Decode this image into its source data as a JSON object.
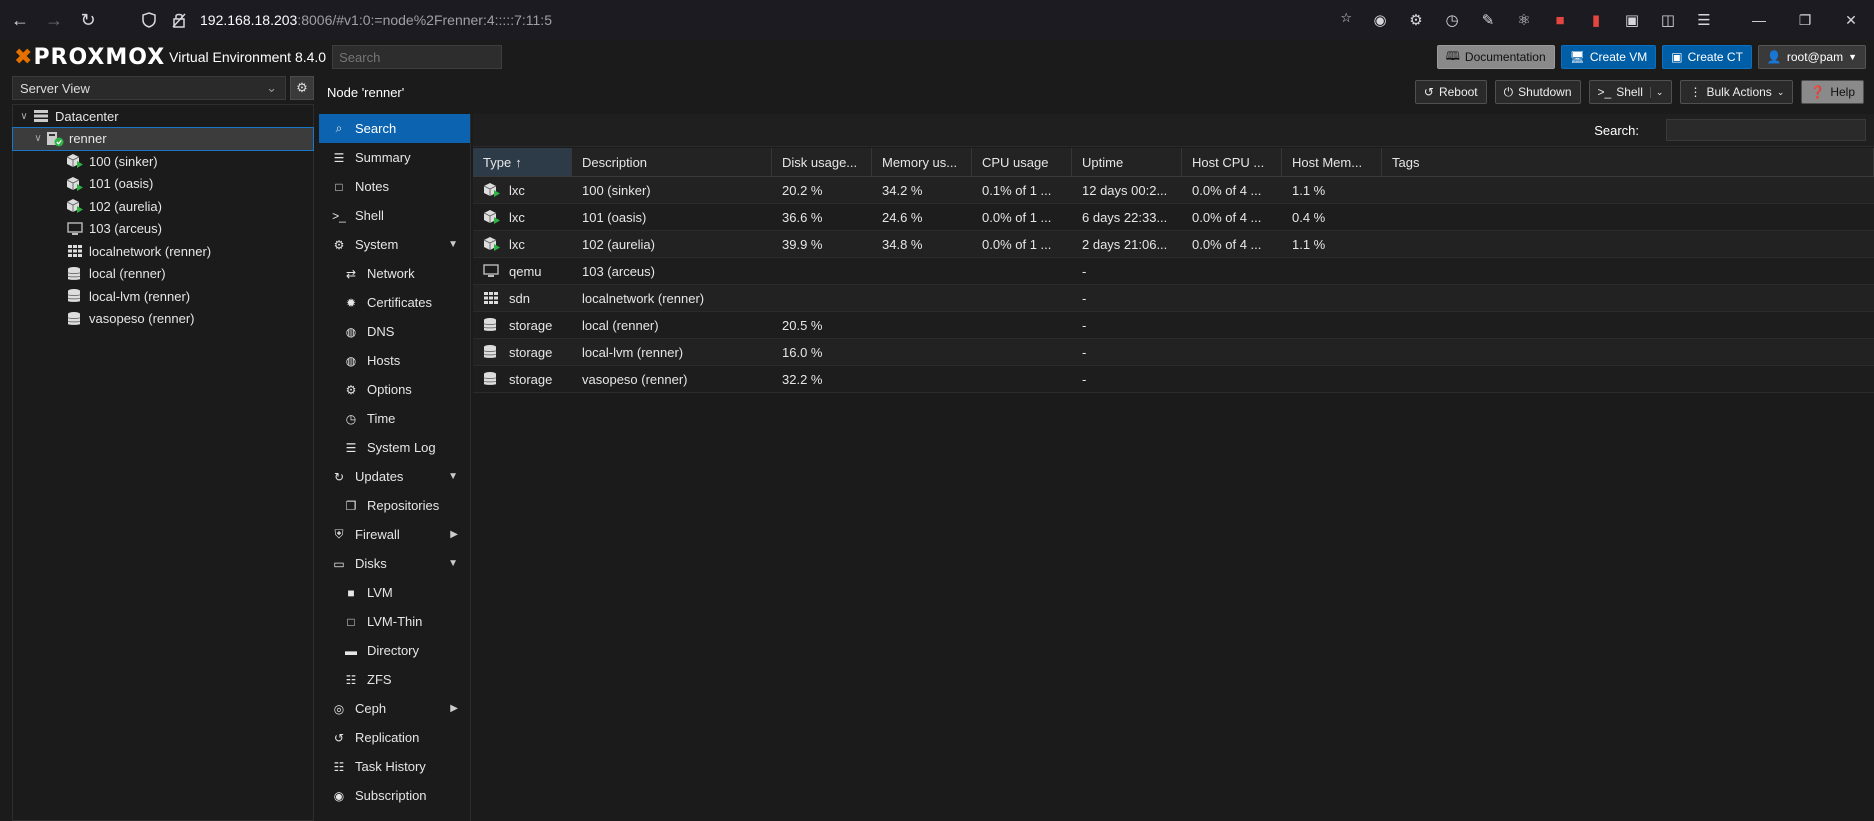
{
  "browser": {
    "url_host": "192.168.18.203",
    "url_rest": ":8006/#v1:0:=node%2Frenner:4:::::7:11:5"
  },
  "header": {
    "logo_text": "PROXMOX",
    "version": "Virtual Environment 8.4.0",
    "search_placeholder": "Search",
    "documentation": "Documentation",
    "create_vm": "Create VM",
    "create_ct": "Create CT",
    "user": "root@pam"
  },
  "left": {
    "view": "Server View",
    "tree": [
      {
        "label": "Datacenter",
        "icon": "datacenter-icon",
        "level": 0
      },
      {
        "label": "renner",
        "icon": "node-online-icon",
        "level": 1,
        "selected": true
      },
      {
        "label": "100 (sinker)",
        "icon": "container-running-icon",
        "level": 2
      },
      {
        "label": "101 (oasis)",
        "icon": "container-running-icon",
        "level": 2
      },
      {
        "label": "102 (aurelia)",
        "icon": "container-running-icon",
        "level": 2
      },
      {
        "label": "103 (arceus)",
        "icon": "vm-monitor-icon",
        "level": 2
      },
      {
        "label": "localnetwork (renner)",
        "icon": "sdn-grid-icon",
        "level": 2
      },
      {
        "label": "local (renner)",
        "icon": "storage-icon",
        "level": 2
      },
      {
        "label": "local-lvm (renner)",
        "icon": "storage-icon",
        "level": 2
      },
      {
        "label": "vasopeso (renner)",
        "icon": "storage-icon",
        "level": 2
      }
    ]
  },
  "node": {
    "title": "Node 'renner'",
    "reboot": "Reboot",
    "shutdown": "Shutdown",
    "shell": "Shell",
    "bulk_actions": "Bulk Actions",
    "help": "Help"
  },
  "nav": [
    {
      "label": "Search",
      "icon": "search-icon",
      "active": true
    },
    {
      "label": "Summary",
      "icon": "summary-icon"
    },
    {
      "label": "Notes",
      "icon": "notes-icon"
    },
    {
      "label": "Shell",
      "icon": "terminal-icon"
    },
    {
      "label": "System",
      "icon": "cogs-icon",
      "caret": "down"
    },
    {
      "label": "Network",
      "icon": "exchange-icon",
      "sub": true
    },
    {
      "label": "Certificates",
      "icon": "certificate-icon",
      "sub": true
    },
    {
      "label": "DNS",
      "icon": "globe-icon",
      "sub": true
    },
    {
      "label": "Hosts",
      "icon": "globe-icon",
      "sub": true
    },
    {
      "label": "Options",
      "icon": "gear-icon",
      "sub": true
    },
    {
      "label": "Time",
      "icon": "clock-icon",
      "sub": true
    },
    {
      "label": "System Log",
      "icon": "list-icon",
      "sub": true
    },
    {
      "label": "Updates",
      "icon": "refresh-icon",
      "caret": "down"
    },
    {
      "label": "Repositories",
      "icon": "repositories-icon",
      "sub": true
    },
    {
      "label": "Firewall",
      "icon": "shield-icon",
      "caret": "right"
    },
    {
      "label": "Disks",
      "icon": "hdd-icon",
      "caret": "down"
    },
    {
      "label": "LVM",
      "icon": "square-icon",
      "sub": true
    },
    {
      "label": "LVM-Thin",
      "icon": "square-outline-icon",
      "sub": true
    },
    {
      "label": "Directory",
      "icon": "folder-icon",
      "sub": true
    },
    {
      "label": "ZFS",
      "icon": "grid-icon",
      "sub": true
    },
    {
      "label": "Ceph",
      "icon": "ceph-icon",
      "caret": "right"
    },
    {
      "label": "Replication",
      "icon": "retweet-icon"
    },
    {
      "label": "Task History",
      "icon": "list-alt-icon"
    },
    {
      "label": "Subscription",
      "icon": "support-icon"
    }
  ],
  "content": {
    "search_label": "Search:",
    "columns": [
      "Type",
      "Description",
      "Disk usage...",
      "Memory us...",
      "CPU usage",
      "Uptime",
      "Host CPU ...",
      "Host Mem...",
      "Tags"
    ],
    "sort_indicator": "↑",
    "rows": [
      {
        "type": "lxc",
        "icon": "container-running-icon",
        "desc": "100 (sinker)",
        "disk": "20.2 %",
        "mem": "34.2 %",
        "cpu": "0.1% of 1 ...",
        "uptime": "12 days 00:2...",
        "hcpu": "0.0% of 4 ...",
        "hmem": "1.1 %",
        "tags": ""
      },
      {
        "type": "lxc",
        "icon": "container-running-icon",
        "desc": "101 (oasis)",
        "disk": "36.6 %",
        "mem": "24.6 %",
        "cpu": "0.0% of 1 ...",
        "uptime": "6 days 22:33...",
        "hcpu": "0.0% of 4 ...",
        "hmem": "0.4 %",
        "tags": ""
      },
      {
        "type": "lxc",
        "icon": "container-running-icon",
        "desc": "102 (aurelia)",
        "disk": "39.9 %",
        "mem": "34.8 %",
        "cpu": "0.0% of 1 ...",
        "uptime": "2 days 21:06...",
        "hcpu": "0.0% of 4 ...",
        "hmem": "1.1 %",
        "tags": ""
      },
      {
        "type": "qemu",
        "icon": "vm-monitor-icon",
        "desc": "103 (arceus)",
        "disk": "",
        "mem": "",
        "cpu": "",
        "uptime": "-",
        "hcpu": "",
        "hmem": "",
        "tags": ""
      },
      {
        "type": "sdn",
        "icon": "sdn-grid-icon",
        "desc": "localnetwork (renner)",
        "disk": "",
        "mem": "",
        "cpu": "",
        "uptime": "-",
        "hcpu": "",
        "hmem": "",
        "tags": ""
      },
      {
        "type": "storage",
        "icon": "storage-icon",
        "desc": "local (renner)",
        "disk": "20.5 %",
        "mem": "",
        "cpu": "",
        "uptime": "-",
        "hcpu": "",
        "hmem": "",
        "tags": ""
      },
      {
        "type": "storage",
        "icon": "storage-icon",
        "desc": "local-lvm (renner)",
        "disk": "16.0 %",
        "mem": "",
        "cpu": "",
        "uptime": "-",
        "hcpu": "",
        "hmem": "",
        "tags": ""
      },
      {
        "type": "storage",
        "icon": "storage-icon",
        "desc": "vasopeso (renner)",
        "disk": "32.2 %",
        "mem": "",
        "cpu": "",
        "uptime": "-",
        "hcpu": "",
        "hmem": "",
        "tags": ""
      }
    ]
  },
  "colors": {
    "accent": "#0c64b0",
    "brand_orange": "#e57000",
    "running_green": "#2fb344"
  }
}
